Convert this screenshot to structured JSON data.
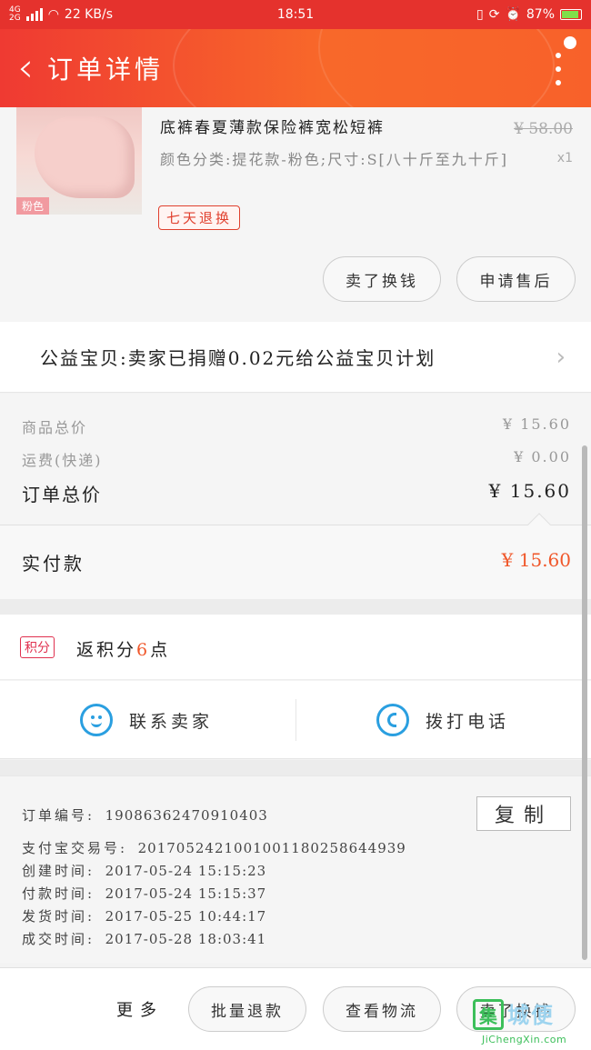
{
  "status_bar": {
    "network": "4G²\n2G",
    "network_top": "4G",
    "network_bottom": "2G",
    "speed": "22 KB/s",
    "time": "18:51",
    "battery": "87%"
  },
  "nav": {
    "back_icon": "back-chevron-icon",
    "title": "订单详情",
    "more_icon": "more-vertical-icon"
  },
  "product": {
    "title_line": "底裤春夏薄款保险裤宽松短裤",
    "spec": "颜色分类:提花款-粉色;尺寸:S[八十斤至九十斤]",
    "old_price": "¥ 58.00",
    "qty": "x1",
    "thumb_tag": "粉色",
    "badge": "七天退换",
    "btn_sell_again": "卖了换钱",
    "btn_after_sale": "申请售后"
  },
  "charity": {
    "text": "公益宝贝:卖家已捐赠0.02元给公益宝贝计划"
  },
  "totals": {
    "goods_label": "商品总价",
    "goods_value": "¥ 15.60",
    "shipping_label": "运费(快递)",
    "shipping_value": "¥ 0.00",
    "order_total_label": "订单总价",
    "order_total_value": "¥ 15.60"
  },
  "paid": {
    "label": "实付款",
    "value": "¥ 15.60"
  },
  "points": {
    "tag": "积分",
    "prefix": "返积分",
    "count": "6",
    "suffix": "点"
  },
  "contact": {
    "seller_label": "联系卖家",
    "call_label": "拨打电话"
  },
  "order_info": {
    "order_no_label": "订单编号:",
    "order_no": "1908636247091040 3",
    "order_no_clean": "19086362470910403",
    "copy_label": "复制",
    "alipay_label": "支付宝交易号:",
    "alipay_no": "2017052421001001180258644939",
    "created_label": "创建时间:",
    "created": "2017-05-24 15:15:23",
    "paid_label": "付款时间:",
    "paid": "2017-05-24 15:15:37",
    "shipped_label": "发货时间:",
    "shipped": "2017-05-25 10:44:17",
    "done_label": "成交时间:",
    "done": "2017-05-28 18:03:41"
  },
  "bottom_bar": {
    "more": "更多",
    "batch_refund": "批量退款",
    "logistics": "查看物流",
    "sell_again": "卖了换钱"
  },
  "watermark": {
    "text": "城便",
    "url": "JiChengXin.com"
  },
  "colors": {
    "brand_red": "#e5322d",
    "brand_orange": "#f8682a",
    "price_orange": "#f0572a",
    "link_blue": "#2a9fe0"
  }
}
